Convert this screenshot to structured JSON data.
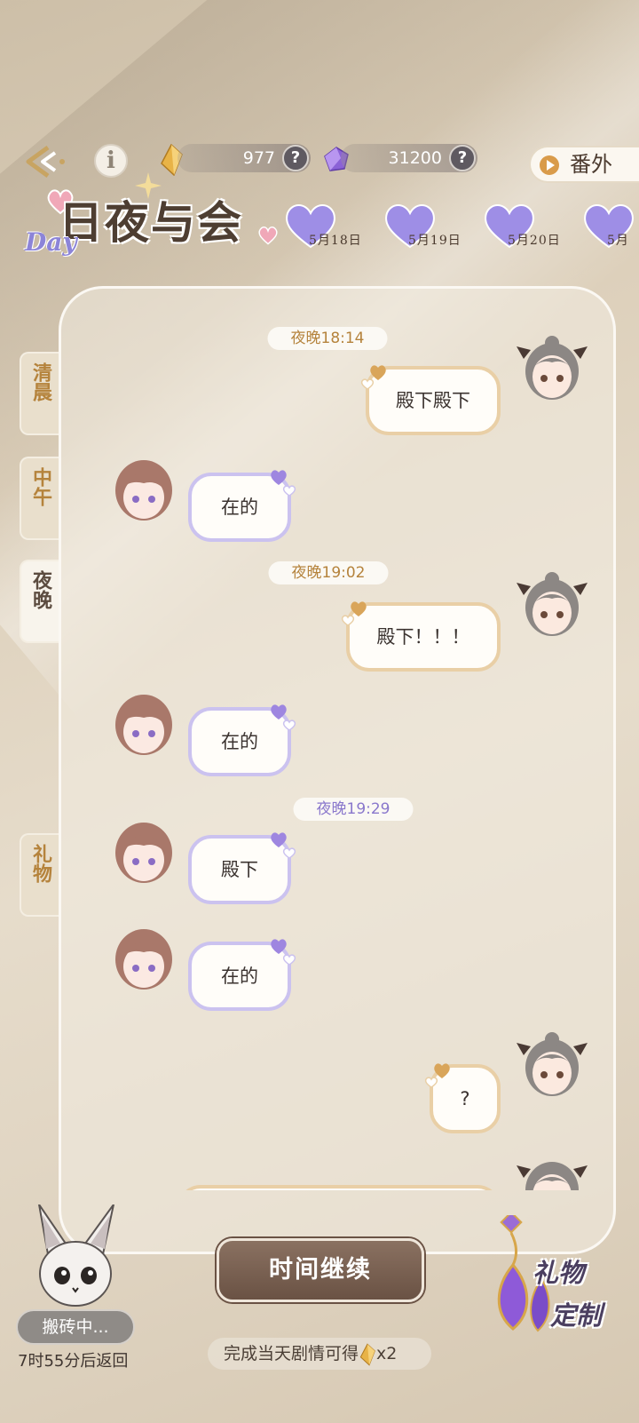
{
  "header": {
    "gold_value": "977",
    "gem_value": "31200",
    "gold_help": "?",
    "gem_help": "?",
    "info_symbol": "i",
    "extra_label": "番外"
  },
  "logo": {
    "title": "日夜与会",
    "accent": "Day"
  },
  "date_tabs": [
    "5月18日",
    "5月19日",
    "5月20日",
    "5月"
  ],
  "side_tabs": [
    {
      "label": "清晨",
      "active": false
    },
    {
      "label": "中午",
      "active": false
    },
    {
      "label": "夜晚",
      "active": true
    },
    {
      "label": "礼物",
      "active": false
    }
  ],
  "chat": {
    "timestamps": [
      "夜晚18:14",
      "夜晚19:02",
      "夜晚19:29"
    ],
    "messages": [
      {
        "from": "me",
        "text": "殿下殿下"
      },
      {
        "from": "them",
        "text": "在的"
      },
      {
        "from": "me",
        "text": "殿下！！！"
      },
      {
        "from": "them",
        "text": "在的"
      },
      {
        "from": "them",
        "text": "殿下"
      },
      {
        "from": "them",
        "text": "在的"
      },
      {
        "from": "me",
        "text": "?"
      }
    ]
  },
  "bottom": {
    "continue_label": "时间继续",
    "reward_text": "完成当天剧情可得",
    "reward_count": "x2",
    "busy_label": "搬砖中...",
    "return_text": "7时55分后返回",
    "gift_line1": "礼物",
    "gift_line2": "定制"
  },
  "colors": {
    "accent_gold": "#e9cfa6",
    "accent_purple": "#cbc2ef",
    "timestamp_gold": "#b5833c",
    "timestamp_purple": "#8a78cc",
    "button_brown": "#7a6252"
  }
}
